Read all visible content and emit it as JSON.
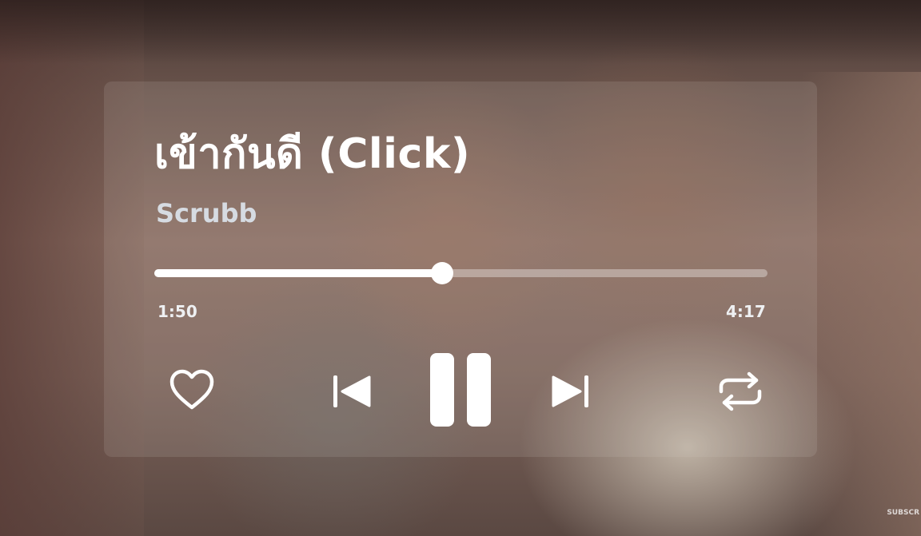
{
  "player": {
    "song_title": "เข้ากันดี (Click)",
    "artist": "Scrubb",
    "progress_fraction": 0.469,
    "elapsed": "1:50",
    "duration": "4:17"
  },
  "controls": {
    "like_icon": "heart-outline-icon",
    "previous_icon": "skip-previous-icon",
    "pause_icon": "pause-icon",
    "next_icon": "skip-next-icon",
    "repeat_icon": "repeat-icon"
  },
  "overlay": {
    "watermark": "SUBSCR"
  },
  "colors": {
    "text_primary": "#ffffff",
    "artist_text": "#d6dbe2",
    "track_fill": "#ffffff",
    "track_rest": "rgba(255,255,255,0.35)"
  }
}
